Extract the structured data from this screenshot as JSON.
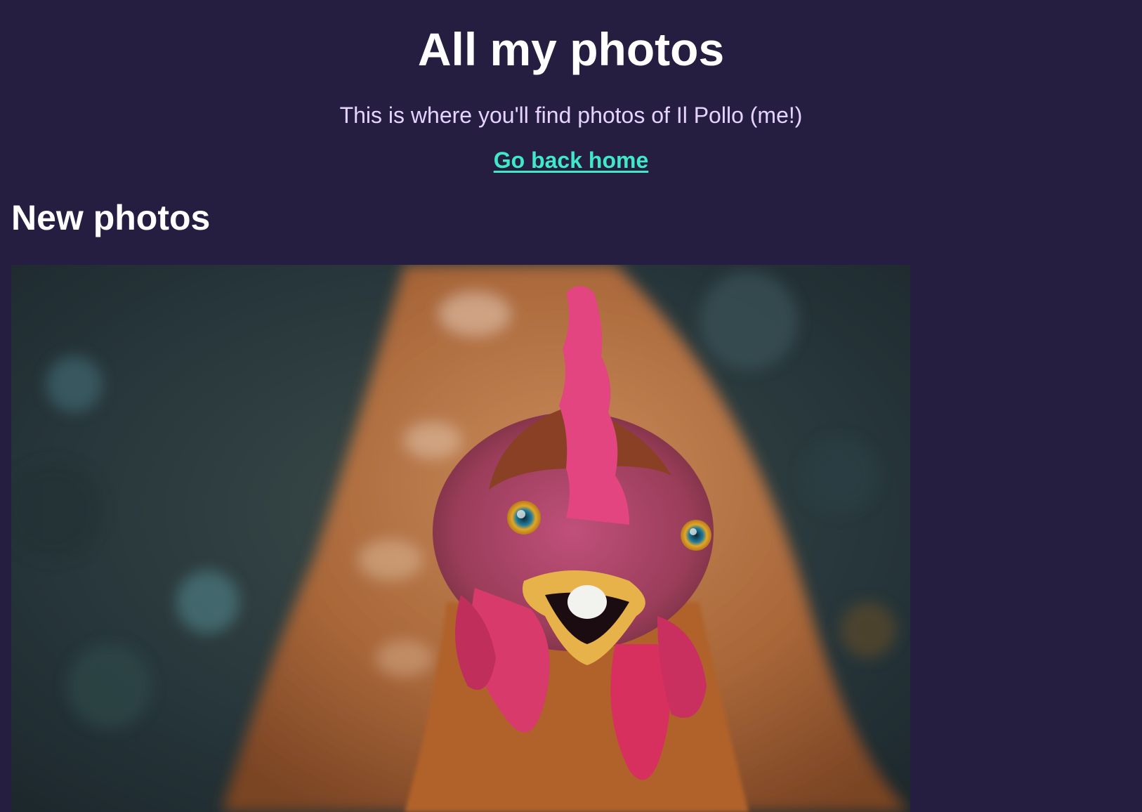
{
  "header": {
    "title": "All my photos",
    "subtitle": "This is where you'll find photos of Il Pollo (me!)",
    "home_link_label": "Go back home"
  },
  "sections": {
    "new_photos": {
      "title": "New photos"
    }
  },
  "colors": {
    "background": "#251e40",
    "subtitle_text": "#e6d3ff",
    "link": "#3fe9c8",
    "heading_text": "#ffffff"
  },
  "photo": {
    "subject": "chicken close-up"
  }
}
